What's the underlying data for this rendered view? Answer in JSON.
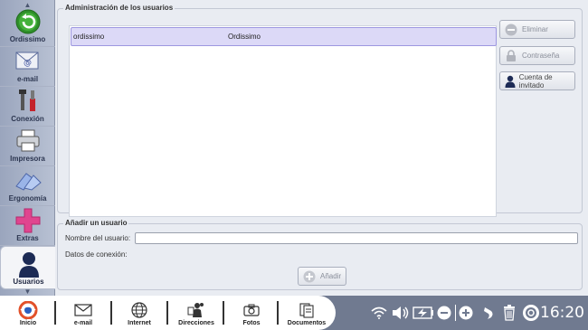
{
  "sidebar": {
    "items": [
      {
        "label": "Ordissimo",
        "icon": "back-arrow-icon"
      },
      {
        "label": "e-mail",
        "icon": "envelope-icon"
      },
      {
        "label": "Conexión",
        "icon": "tools-icon"
      },
      {
        "label": "Impresora",
        "icon": "printer-icon"
      },
      {
        "label": "Ergonomía",
        "icon": "cards-icon"
      },
      {
        "label": "Extras",
        "icon": "plus-icon"
      },
      {
        "label": "Usuarios",
        "icon": "user-icon"
      }
    ]
  },
  "users_section": {
    "title": "Administración de los usuarios",
    "rows": [
      {
        "login": "ordissimo",
        "name": "Ordissimo"
      }
    ],
    "buttons": {
      "delete": "Eliminar",
      "password": "Contraseña",
      "guest": "Cuenta de invitado"
    }
  },
  "add_section": {
    "title": "Añadir un usuario",
    "name_label": "Nombre del usuario:",
    "name_value": "",
    "connection_label": "Datos de conexión:",
    "add_button": "Añadir"
  },
  "taskbar": {
    "items": [
      {
        "label": "Inicio",
        "icon": "ordissimo-logo-icon"
      },
      {
        "label": "e-mail",
        "icon": "envelope-icon"
      },
      {
        "label": "Internet",
        "icon": "globe-icon"
      },
      {
        "label": "Direcciones",
        "icon": "contacts-icon"
      },
      {
        "label": "Fotos",
        "icon": "camera-icon"
      },
      {
        "label": "Documentos",
        "icon": "documents-icon"
      }
    ],
    "clock": "16:20"
  },
  "colors": {
    "selection": "#dcd9f7",
    "taskbar": "#707a90",
    "extras_accent": "#e0458f",
    "inicio_accent": "#e2512a"
  }
}
